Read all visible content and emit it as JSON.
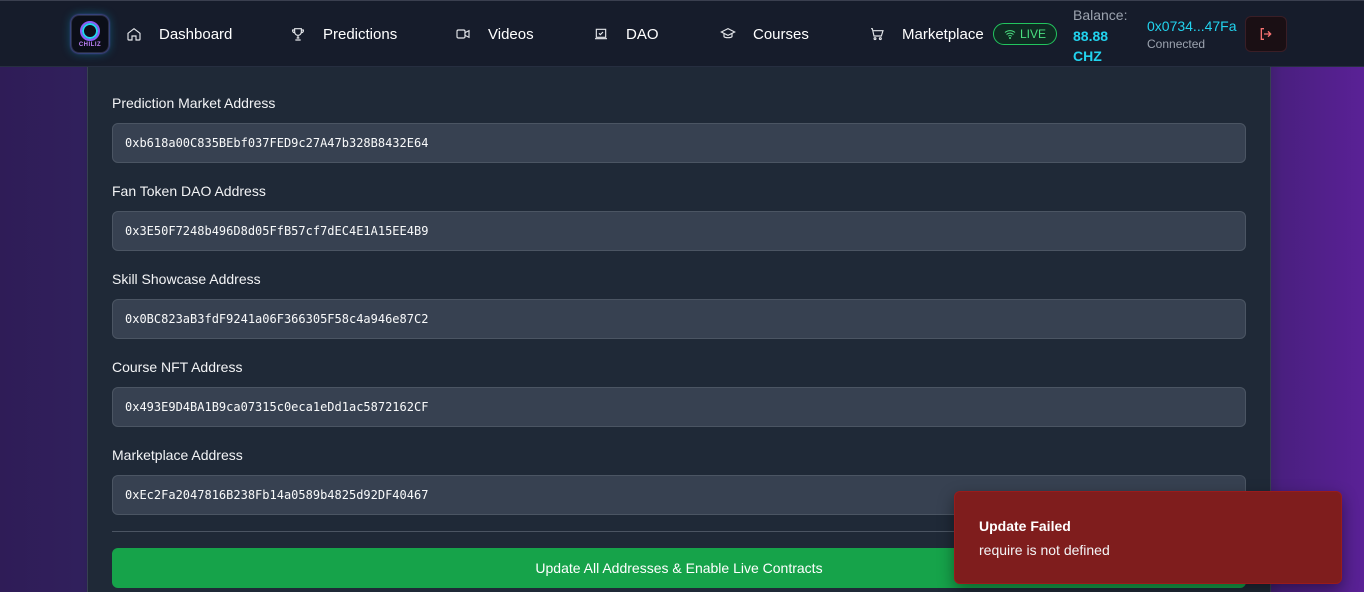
{
  "nav": {
    "logo_text": "CHILIZ",
    "items": [
      {
        "label": "Dashboard",
        "icon": "home-icon"
      },
      {
        "label": "Predictions",
        "icon": "trophy-icon"
      },
      {
        "label": "Videos",
        "icon": "video-icon"
      },
      {
        "label": "DAO",
        "icon": "vote-icon"
      },
      {
        "label": "Courses",
        "icon": "graduation-cap-icon"
      },
      {
        "label": "Marketplace",
        "icon": "cart-icon"
      }
    ],
    "live_badge": "LIVE",
    "balance_label": "Balance:",
    "balance_value": "88.88 CHZ",
    "wallet_address": "0x0734...47Fa",
    "wallet_status": "Connected",
    "logout_icon": "logout-icon"
  },
  "form": {
    "fields": [
      {
        "label": "Prediction Market Address",
        "value": "0xb618a00C835BEbf037FED9c27A47b328B8432E64"
      },
      {
        "label": "Fan Token DAO Address",
        "value": "0x3E50F7248b496D8d05FfB57cf7dEC4E1A15EE4B9"
      },
      {
        "label": "Skill Showcase Address",
        "value": "0x0BC823aB3fdF9241a06F366305F58c4a946e87C2"
      },
      {
        "label": "Course NFT Address",
        "value": "0x493E9D4BA1B9ca07315c0eca1eDd1ac5872162CF"
      },
      {
        "label": "Marketplace Address",
        "value": "0xEc2Fa2047816B238Fb14a0589b4825d92DF40467"
      }
    ],
    "submit_label": "Update All Addresses & Enable Live Contracts"
  },
  "toast": {
    "title": "Update Failed",
    "message": "require is not defined"
  },
  "colors": {
    "accent_cyan": "#22d3ee",
    "success_green": "#16a34a",
    "error_red": "#7f1d1d"
  }
}
